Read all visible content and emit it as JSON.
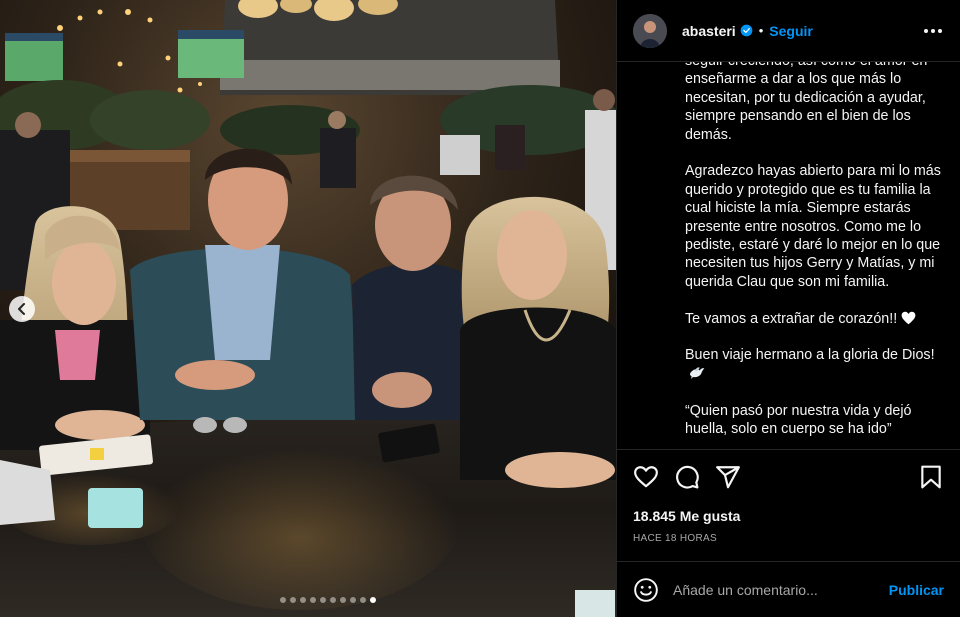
{
  "header": {
    "username": "abasteri",
    "separator": "•",
    "follow_label": "Seguir"
  },
  "caption": {
    "paragraphs": [
      "seguir creciendo, así como el amor en enseñarme a dar a los que más lo necesitan, por tu dedicación a ayudar, siempre pensando en el bien de los demás.",
      "Agradezco hayas abierto para mi lo más querido y protegido que es tu familia la cual hiciste la mía. Siempre estarás presente entre nosotros. Como me lo pediste, estaré y daré lo mejor en lo que necesiten tus hijos Gerry y Matías, y mi querida Clau que son mi familia.",
      "Te vamos a extrañar de corazón!!",
      "Buen viaje hermano a la gloria de Dios!",
      "“Quien pasó por nuestra vida y dejó huella, solo en cuerpo se ha ido”"
    ]
  },
  "stats": {
    "likes": "18.845 Me gusta",
    "time_ago": "HACE 18 HORAS"
  },
  "comment": {
    "placeholder": "Añade un comentario...",
    "publish_label": "Publicar"
  },
  "carousel": {
    "total": 10,
    "active_index": 9
  },
  "colors": {
    "accent": "#0095f6",
    "background": "#000000",
    "divider": "#262626",
    "muted_text": "#a8a8a8"
  },
  "icons": [
    "verified-badge-icon",
    "more-options-icon",
    "heart-icon",
    "comment-icon",
    "share-icon",
    "bookmark-icon",
    "emoji-icon",
    "chevron-left-icon",
    "white-heart-icon",
    "dove-icon"
  ]
}
